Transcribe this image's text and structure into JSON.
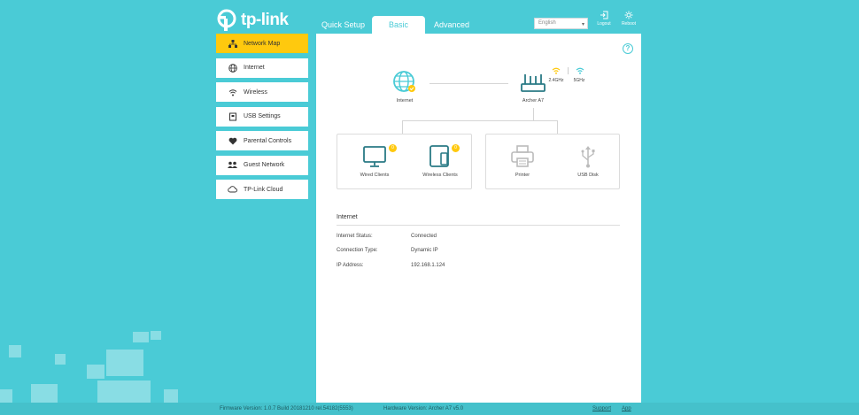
{
  "brand": {
    "logo_text": "tp-link"
  },
  "header": {
    "tabs": [
      {
        "label": "Quick Setup"
      },
      {
        "label": "Basic",
        "active": true
      },
      {
        "label": "Advanced"
      }
    ],
    "language": {
      "selected": "English"
    },
    "buttons": [
      {
        "label": "Logout",
        "icon": "logout-icon"
      },
      {
        "label": "Reboot",
        "icon": "reboot-icon"
      }
    ]
  },
  "sidebar": {
    "items": [
      {
        "label": "Network Map",
        "icon": "network-map-icon",
        "active": true
      },
      {
        "label": "Internet",
        "icon": "globe-icon"
      },
      {
        "label": "Wireless",
        "icon": "wifi-icon"
      },
      {
        "label": "USB Settings",
        "icon": "usb-settings-icon"
      },
      {
        "label": "Parental Controls",
        "icon": "heart-icon"
      },
      {
        "label": "Guest Network",
        "icon": "guest-users-icon"
      },
      {
        "label": "TP-Link Cloud",
        "icon": "cloud-icon"
      }
    ]
  },
  "network_map": {
    "internet_label": "Internet",
    "router_label": "Archer A7",
    "band_24": "2.4GHz",
    "band_5": "5GHz",
    "wired_clients": {
      "label": "Wired Clients",
      "count": "0"
    },
    "wireless_clients": {
      "label": "Wireless Clients",
      "count": "0"
    },
    "printer": {
      "label": "Printer"
    },
    "usb_disk": {
      "label": "USB Disk"
    }
  },
  "internet_info": {
    "title": "Internet",
    "rows": [
      {
        "key": "Internet Status:",
        "value": "Connected"
      },
      {
        "key": "Connection Type:",
        "value": "Dynamic IP"
      },
      {
        "key": "IP Address:",
        "value": "192.168.1.124"
      }
    ]
  },
  "footer": {
    "firmware": "Firmware Version: 1.0.7 Build 20181210 rel.54182(5553)",
    "hardware": "Hardware Version: Archer A7 v5.0",
    "support": "Support",
    "app": "App"
  },
  "colors": {
    "background": "#4acbd6",
    "accent": "#ffc90e",
    "panel": "#ffffff"
  }
}
